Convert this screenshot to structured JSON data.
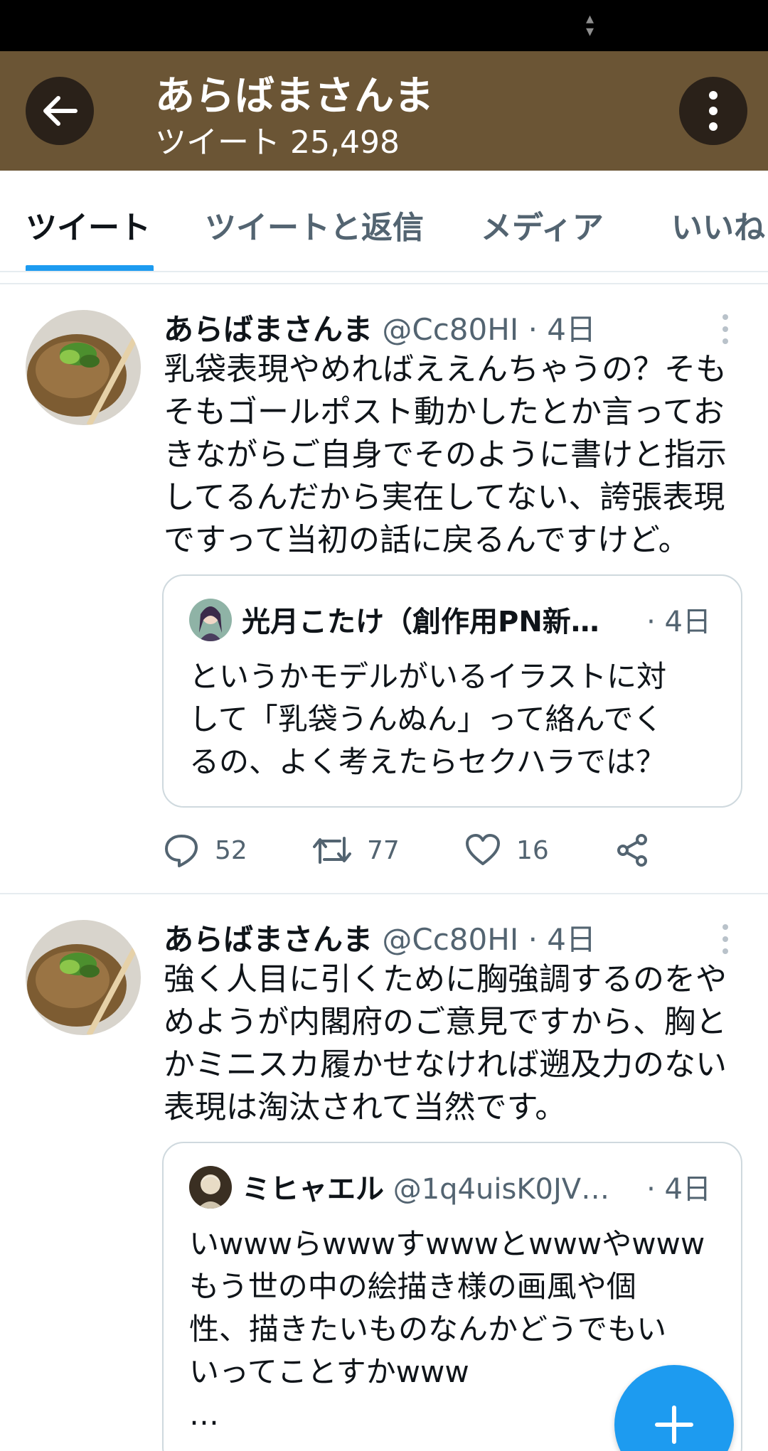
{
  "header": {
    "title": "あらばまさんま",
    "subtitle": "ツイート 25,498"
  },
  "tabs": [
    "ツイート",
    "ツイートと返信",
    "メディア",
    "いいね"
  ],
  "tweets": [
    {
      "name": "あらばまさんま",
      "handle": "@Cc80HI",
      "time": "· 4日",
      "text": "乳袋表現やめればええんちゃうの？そも\nそもゴールポスト動かしたとか言ってお\nきながらご自身でそのように書けと指示\nしてるんだから実在してない、誇張表現\nですって当初の話に戻るんですけど。",
      "quote": {
        "name": "光月こたけ（創作用PN新…",
        "handle": "",
        "time": "· 4日",
        "text": "というかモデルがいるイラストに対\nして「乳袋うんぬん」って絡んでく\nるの、よく考えたらセクハラでは？"
      },
      "replies": "52",
      "retweets": "77",
      "likes": "16"
    },
    {
      "name": "あらばまさんま",
      "handle": "@Cc80HI",
      "time": "· 4日",
      "text": "強く人目に引くために胸強調するのをや\nめようが内閣府のご意見ですから、胸と\nかミニスカ履かせなければ遡及力のない\n表現は淘汰されて当然です。",
      "quote": {
        "name": "ミヒャエル",
        "handle": "@1q4uisK0JV…",
        "time": "· 4日",
        "text": "いwwwらwwwすwwwとwwwやwww\nもう世の中の絵描き様の画風や個\n性、描きたいものなんかどうでもい\nいってことすかwww\n…"
      }
    }
  ],
  "icons": {
    "back": "arrow-left-icon",
    "more": "more-vertical-icon",
    "reply": "reply-icon",
    "retweet": "retweet-icon",
    "like": "heart-icon",
    "share": "share-icon",
    "compose": "plus-icon"
  },
  "colors": {
    "header_bg": "#6b5535",
    "accent": "#1d9bf0"
  }
}
